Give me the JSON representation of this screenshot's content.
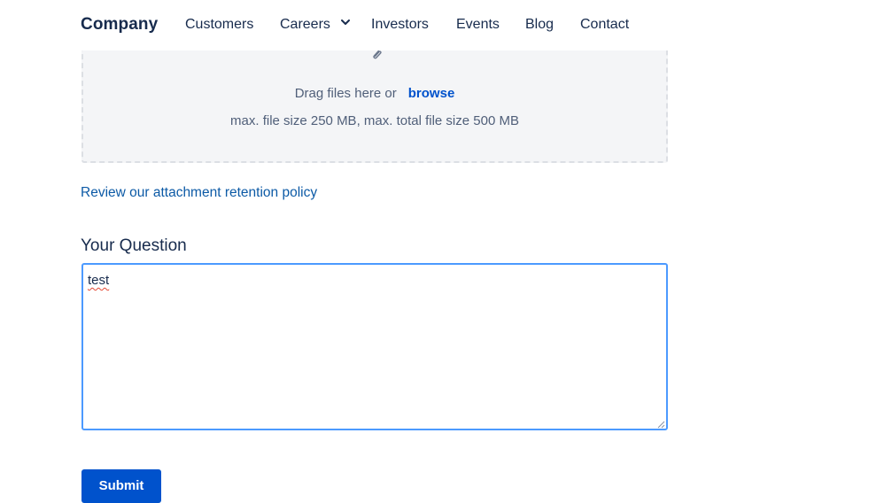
{
  "nav": {
    "brand": "Company",
    "items": [
      {
        "label": "Customers"
      },
      {
        "label": "Careers",
        "has_dropdown": true
      },
      {
        "label": "Investors"
      },
      {
        "label": "Events"
      },
      {
        "label": "Blog"
      },
      {
        "label": "Contact"
      }
    ]
  },
  "upload": {
    "icon": "paperclip-icon",
    "drag_text": "Drag files here or",
    "browse_label": "browse",
    "limits_text": "max. file size 250 MB, max. total file size 500 MB"
  },
  "policy_link": "Review our attachment retention policy",
  "question": {
    "label": "Your Question",
    "value": "test"
  },
  "submit_label": "Submit",
  "colors": {
    "link": "#0052cc",
    "button": "#0052cc",
    "focus_border": "#4c9aff",
    "dropzone_bg": "#f4f5f7"
  }
}
